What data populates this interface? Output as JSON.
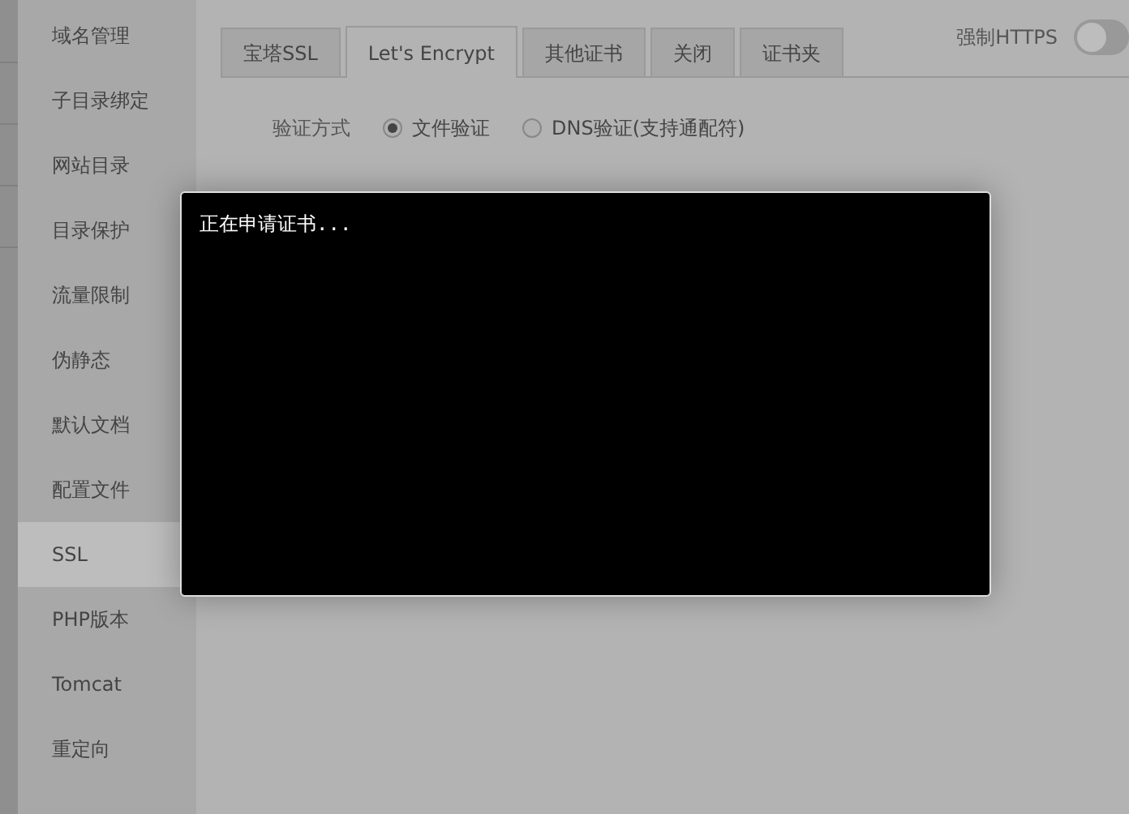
{
  "sidebar": {
    "items": [
      {
        "label": "域名管理",
        "selected": false
      },
      {
        "label": "子目录绑定",
        "selected": false
      },
      {
        "label": "网站目录",
        "selected": false
      },
      {
        "label": "目录保护",
        "selected": false
      },
      {
        "label": "流量限制",
        "selected": false
      },
      {
        "label": "伪静态",
        "selected": false
      },
      {
        "label": "默认文档",
        "selected": false
      },
      {
        "label": "配置文件",
        "selected": false
      },
      {
        "label": "SSL",
        "selected": true
      },
      {
        "label": "PHP版本",
        "selected": false
      },
      {
        "label": "Tomcat",
        "selected": false
      },
      {
        "label": "重定向",
        "selected": false
      }
    ]
  },
  "tabs": [
    {
      "label": "宝塔SSL",
      "selected": false
    },
    {
      "label": "Let's Encrypt",
      "selected": true
    },
    {
      "label": "其他证书",
      "selected": false
    },
    {
      "label": "关闭",
      "selected": false
    },
    {
      "label": "证书夹",
      "selected": false
    }
  ],
  "force_https": {
    "label": "强制HTTPS",
    "on": false
  },
  "verification": {
    "label": "验证方式",
    "options": [
      {
        "label": "文件验证",
        "selected": true
      },
      {
        "label": "DNS验证(支持通配符)",
        "selected": false
      }
    ]
  },
  "console": {
    "text": "正在申请证书..."
  }
}
